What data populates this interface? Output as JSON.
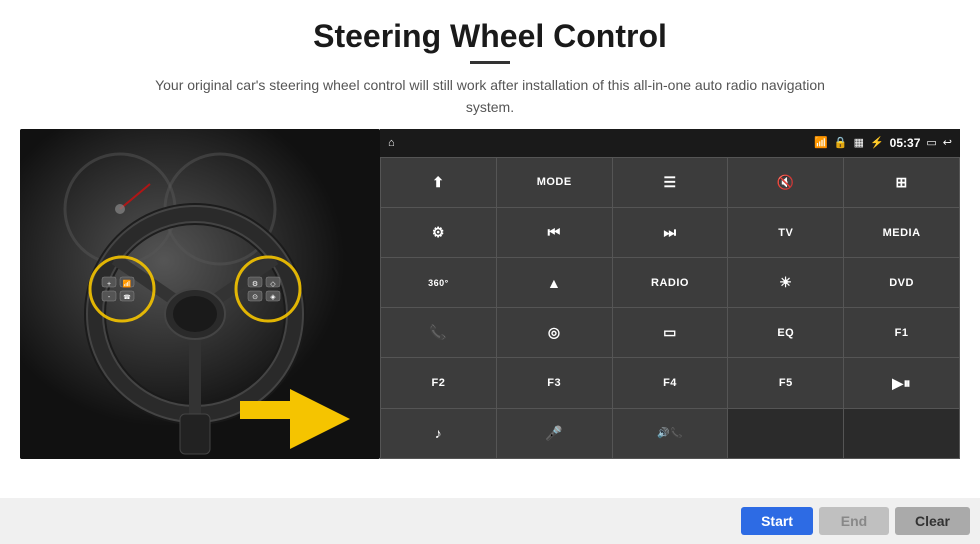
{
  "header": {
    "title": "Steering Wheel Control",
    "subtitle": "Your original car's steering wheel control will still work after installation of this all-in-one auto radio navigation system."
  },
  "statusBar": {
    "time": "05:37",
    "icons": [
      "wifi",
      "lock",
      "sim",
      "bluetooth",
      "battery",
      "screen",
      "back"
    ]
  },
  "buttonGrid": [
    [
      {
        "icon": "nav",
        "label": "",
        "type": "icon"
      },
      {
        "icon": "",
        "label": "MODE",
        "type": "text"
      },
      {
        "icon": "≡",
        "label": "",
        "type": "icon"
      },
      {
        "icon": "🔇",
        "label": "",
        "type": "icon"
      },
      {
        "icon": "⊞",
        "label": "",
        "type": "icon"
      }
    ],
    [
      {
        "icon": "⚙",
        "label": "",
        "type": "icon"
      },
      {
        "icon": "⏮",
        "label": "",
        "type": "icon"
      },
      {
        "icon": "⏭",
        "label": "",
        "type": "icon"
      },
      {
        "icon": "",
        "label": "TV",
        "type": "text"
      },
      {
        "icon": "",
        "label": "MEDIA",
        "type": "text"
      }
    ],
    [
      {
        "icon": "360",
        "label": "",
        "type": "icon"
      },
      {
        "icon": "▲",
        "label": "",
        "type": "icon"
      },
      {
        "icon": "",
        "label": "RADIO",
        "type": "text"
      },
      {
        "icon": "☀",
        "label": "",
        "type": "icon"
      },
      {
        "icon": "",
        "label": "DVD",
        "type": "text"
      }
    ],
    [
      {
        "icon": "📞",
        "label": "",
        "type": "icon"
      },
      {
        "icon": "◎",
        "label": "",
        "type": "icon"
      },
      {
        "icon": "▭",
        "label": "",
        "type": "icon"
      },
      {
        "icon": "",
        "label": "EQ",
        "type": "text"
      },
      {
        "icon": "",
        "label": "F1",
        "type": "text"
      }
    ],
    [
      {
        "icon": "",
        "label": "F2",
        "type": "text"
      },
      {
        "icon": "",
        "label": "F3",
        "type": "text"
      },
      {
        "icon": "",
        "label": "F4",
        "type": "text"
      },
      {
        "icon": "",
        "label": "F5",
        "type": "text"
      },
      {
        "icon": "▶⏸",
        "label": "",
        "type": "icon"
      }
    ],
    [
      {
        "icon": "♪",
        "label": "",
        "type": "icon"
      },
      {
        "icon": "🎤",
        "label": "",
        "type": "icon"
      },
      {
        "icon": "📢",
        "label": "",
        "type": "icon"
      },
      {
        "icon": "",
        "label": "",
        "type": "empty"
      },
      {
        "icon": "",
        "label": "",
        "type": "empty"
      }
    ]
  ],
  "bottomBar": {
    "startLabel": "Start",
    "endLabel": "End",
    "clearLabel": "Clear"
  }
}
